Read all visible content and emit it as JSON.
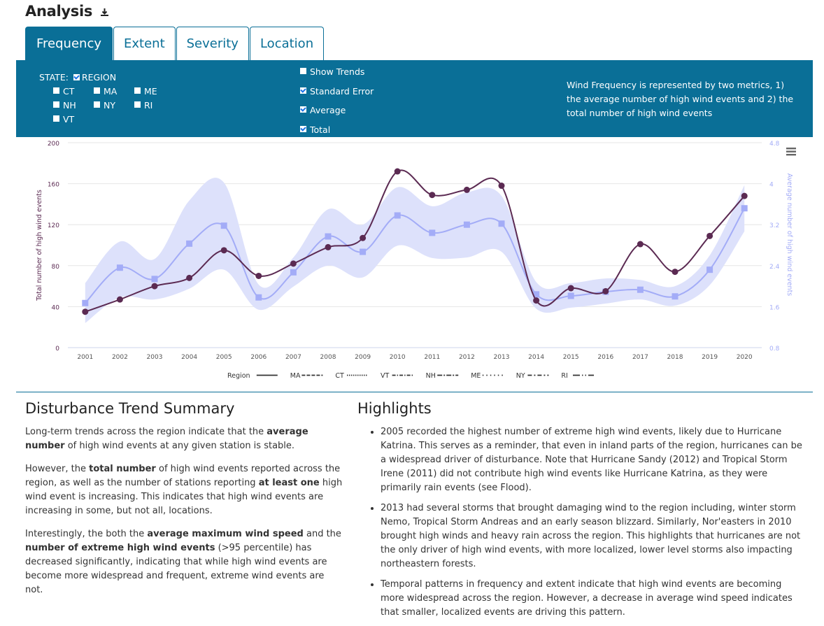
{
  "header": {
    "title": "Analysis",
    "download_icon": "download-icon"
  },
  "tabs": [
    {
      "label": "Frequency",
      "active": true
    },
    {
      "label": "Extent",
      "active": false
    },
    {
      "label": "Severity",
      "active": false
    },
    {
      "label": "Location",
      "active": false
    }
  ],
  "controls": {
    "state_label": "STATE:",
    "region": {
      "label": "REGION",
      "checked": true
    },
    "states": [
      {
        "label": "CT",
        "checked": false
      },
      {
        "label": "MA",
        "checked": false
      },
      {
        "label": "ME",
        "checked": false
      },
      {
        "label": "NH",
        "checked": false
      },
      {
        "label": "NY",
        "checked": false
      },
      {
        "label": "RI",
        "checked": false
      },
      {
        "label": "VT",
        "checked": false
      }
    ],
    "options": [
      {
        "label": "Show Trends",
        "checked": false
      },
      {
        "label": "Standard Error",
        "checked": true
      },
      {
        "label": "Average",
        "checked": true
      },
      {
        "label": "Total",
        "checked": true
      }
    ],
    "info_text": "Wind Frequency is represented by two metrics, 1) the average number of high wind events and 2) the total number of high wind events"
  },
  "colors": {
    "brand": "#0a6f97",
    "total_line": "#5b2a52",
    "average_line": "#a3acf7",
    "se_band": "#dde1fb"
  },
  "chart_data": {
    "type": "line",
    "title": "",
    "x": [
      2001,
      2002,
      2003,
      2004,
      2005,
      2006,
      2007,
      2008,
      2009,
      2010,
      2011,
      2012,
      2013,
      2014,
      2015,
      2016,
      2017,
      2018,
      2019,
      2020
    ],
    "xlabel": "",
    "ylabel": "Total number of high wind events",
    "ylabel_right": "Average number of high wind events",
    "ylim": [
      0,
      200
    ],
    "yticks": [
      0,
      40,
      80,
      120,
      160,
      200
    ],
    "ylim_right": [
      0.8,
      4.8
    ],
    "yticks_right": [
      0.8,
      1.6,
      2.4,
      3.2,
      4,
      4.8
    ],
    "grid": true,
    "series": [
      {
        "name": "Total",
        "axis": "left",
        "marker": "circle",
        "values": [
          35,
          47,
          60,
          68,
          95,
          70,
          82,
          98,
          107,
          172,
          149,
          154,
          158,
          46,
          58,
          55,
          101,
          74,
          109,
          148
        ]
      },
      {
        "name": "Average",
        "axis": "right",
        "marker": "square",
        "values": [
          1.67,
          2.36,
          2.14,
          2.83,
          3.18,
          1.78,
          2.27,
          2.97,
          2.67,
          3.38,
          3.04,
          3.2,
          3.22,
          1.84,
          1.81,
          1.89,
          1.93,
          1.8,
          2.32,
          3.52
        ]
      },
      {
        "name": "Standard Error",
        "axis": "right",
        "type": "arearange",
        "upper": [
          2.06,
          2.87,
          2.53,
          3.67,
          4.02,
          2.03,
          2.56,
          3.5,
          3.2,
          3.93,
          3.56,
          3.83,
          3.76,
          2.08,
          2.06,
          2.15,
          2.12,
          2.0,
          2.6,
          3.97
        ],
        "lower": [
          1.28,
          1.78,
          1.74,
          1.95,
          2.32,
          1.54,
          1.99,
          2.4,
          2.17,
          2.79,
          2.55,
          2.56,
          2.67,
          1.56,
          1.58,
          1.66,
          1.74,
          1.62,
          2.02,
          3.07
        ]
      }
    ],
    "legend": {
      "placement": "bottom",
      "entries": [
        {
          "label": "Region",
          "dash": "solid"
        },
        {
          "label": "MA",
          "dash": "dashed"
        },
        {
          "label": "CT",
          "dash": "dotted"
        },
        {
          "label": "VT",
          "dash": "dashdot"
        },
        {
          "label": "NH",
          "dash": "longdashdot"
        },
        {
          "label": "ME",
          "dash": "sparse-dot"
        },
        {
          "label": "NY",
          "dash": "dash-dot-dash"
        },
        {
          "label": "RI",
          "dash": "longdash-dots"
        }
      ]
    }
  },
  "summary": {
    "heading": "Disturbance Trend Summary",
    "paragraphs": [
      [
        {
          "t": "Long-term trends across the region indicate that the "
        },
        {
          "t": "average number",
          "b": true
        },
        {
          "t": " of high wind events at any given station is stable."
        }
      ],
      [
        {
          "t": "However, the "
        },
        {
          "t": "total number",
          "b": true
        },
        {
          "t": " of high wind events reported across the region, as well as the number of stations reporting "
        },
        {
          "t": "at least one",
          "b": true
        },
        {
          "t": " high wind event is increasing. This indicates that high wind events are increasing in some, but not all, locations."
        }
      ],
      [
        {
          "t": "Interestingly, the both the "
        },
        {
          "t": "average maximum wind speed",
          "b": true
        },
        {
          "t": " and the "
        },
        {
          "t": "number of extreme high wind events",
          "b": true
        },
        {
          "t": " (>95 percentile) has decreased significantly, indicating that while high wind events are become more widespread and frequent, extreme wind events are not."
        }
      ]
    ]
  },
  "highlights": {
    "heading": "Highlights",
    "items": [
      "2005 recorded the highest number of extreme high wind events, likely due to Hurricane Katrina. This serves as a reminder, that even in inland parts of the region, hurricanes can be a widespread driver of disturbance. Note that Hurricane Sandy (2012) and Tropical Storm Irene (2011) did not contribute high wind events like Hurricane Katrina, as they were primarily rain events (see Flood).",
      "2013 had several storms that brought damaging wind to the region including, winter storm Nemo, Tropical Storm Andreas and an early season blizzard. Similarly, Nor'easters in 2010 brought high winds and heavy rain across the region. This highlights that hurricanes are not the only driver of high wind events, with more localized, lower level storms also impacting northeastern forests.",
      "Temporal patterns in frequency and extent indicate that high wind events are becoming more widespread across the region. However, a decrease in average wind speed indicates that smaller, localized events are driving this pattern."
    ]
  }
}
